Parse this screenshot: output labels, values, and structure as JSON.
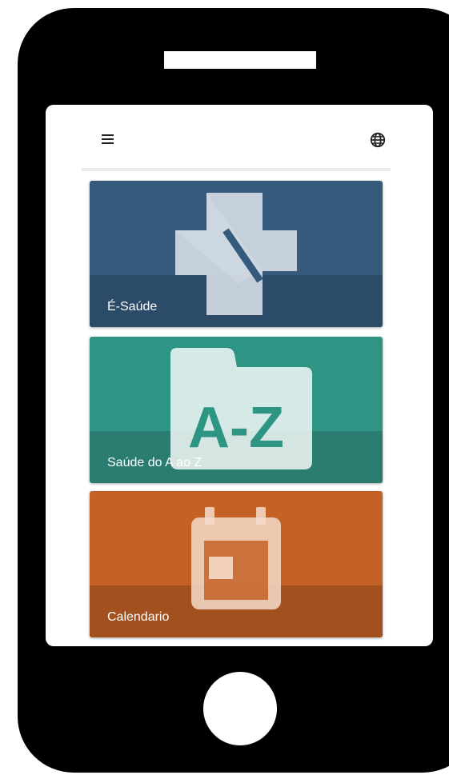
{
  "app": {
    "menu_icon": "hamburger-menu-icon",
    "language_icon": "globe-icon"
  },
  "cards": [
    {
      "label": "É-Saúde",
      "icon": "health-cross-icon",
      "color": "#355a7c",
      "band_color": "#2c4b68"
    },
    {
      "label": "Saúde do A ao Z",
      "icon": "folder-a-z-icon",
      "icon_text": "A-Z",
      "color": "#2e9484",
      "band_color": "#2a7c70"
    },
    {
      "label": "Calendario",
      "icon": "calendar-icon",
      "color": "#c46226",
      "band_color": "#a3501f"
    }
  ]
}
